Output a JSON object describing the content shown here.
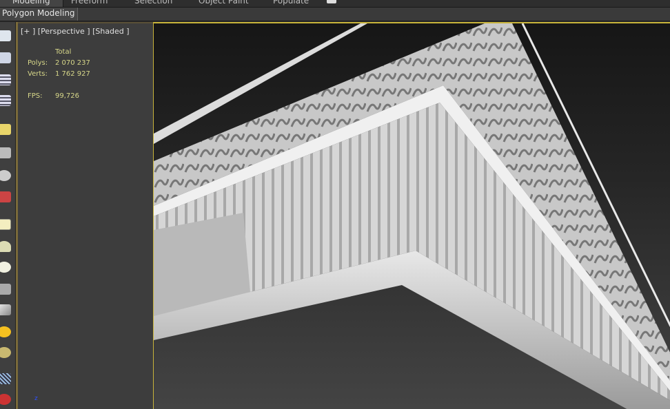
{
  "ribbon": {
    "tabs": [
      "Modeling",
      "Freeform",
      "Selection",
      "Object Paint",
      "Populate"
    ],
    "active": "Modeling"
  },
  "subbar": {
    "label": "Polygon Modeling"
  },
  "viewport": {
    "label": "[+ ] [Perspective ] [Shaded ]",
    "stats": {
      "header": "Total",
      "polys_label": "Polys:",
      "polys": "2 070 237",
      "verts_label": "Verts:",
      "verts": "1 762 927",
      "fps_label": "FPS:",
      "fps": "99,726"
    }
  },
  "axis": {
    "z": "z"
  },
  "toolbar_icons": [
    "teapot-icon",
    "render-frame-icon",
    "layer-list-icon",
    "table-icon",
    "light-icon",
    "camera-icon",
    "sphere-icon",
    "link-icon",
    "plane-icon",
    "dome-icon",
    "sphere-white-icon",
    "teapot-wire-icon",
    "cone-icon",
    "sun-icon",
    "sphere-gold-icon",
    "grid-icon",
    "bone-icon"
  ],
  "colors": {
    "accent": "#c9b43a",
    "stats": "#d8d88a"
  }
}
